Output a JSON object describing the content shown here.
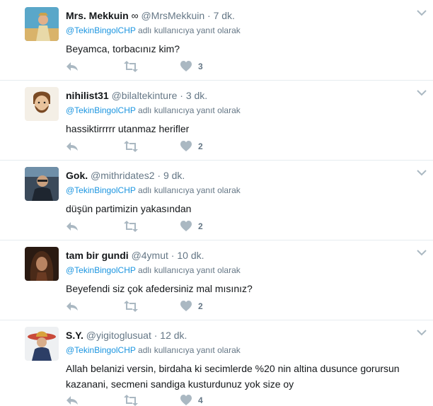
{
  "reply_context": {
    "mention": "@TekinBingolCHP",
    "suffix": "adlı kullanıcıya yanıt olarak"
  },
  "separator": "·",
  "tweets": [
    {
      "name": "Mrs. Mekkuin",
      "badge": "∞",
      "handle": "@MrsMekkuin",
      "time": "7 dk.",
      "text": "Beyamca, torbacınız kim?",
      "like_count": "3"
    },
    {
      "name": "nihilist31",
      "badge": "",
      "handle": "@bilaltekinture",
      "time": "3 dk.",
      "text": "hassiktirrrrr utanmaz herifler",
      "like_count": "2"
    },
    {
      "name": "Gok.",
      "badge": "",
      "handle": "@mithridates2",
      "time": "9 dk.",
      "text": "düşün partimizin yakasından",
      "like_count": "2"
    },
    {
      "name": "tam bir gundi",
      "badge": "",
      "handle": "@4ymut",
      "time": "10 dk.",
      "text": "Beyefendi siz çok afedersiniz mal mısınız?",
      "like_count": "2"
    },
    {
      "name": "S.Y.",
      "badge": "",
      "handle": "@yigitoglusuat",
      "time": "12 dk.",
      "text": "Allah belanizi versin, birdaha ki secimlerde %20 nin altina dusunce gorursun kazanani, secmeni sandiga kusturdunuz yok size oy",
      "like_count": "4"
    }
  ],
  "colors": {
    "text": "#14171a",
    "secondary": "#657786",
    "link": "#1b95e0",
    "icon": "#aab8c2",
    "divider": "#e6ecf0"
  },
  "icons": [
    "reply-icon",
    "retweet-icon",
    "heart-icon",
    "caret-down-icon"
  ]
}
